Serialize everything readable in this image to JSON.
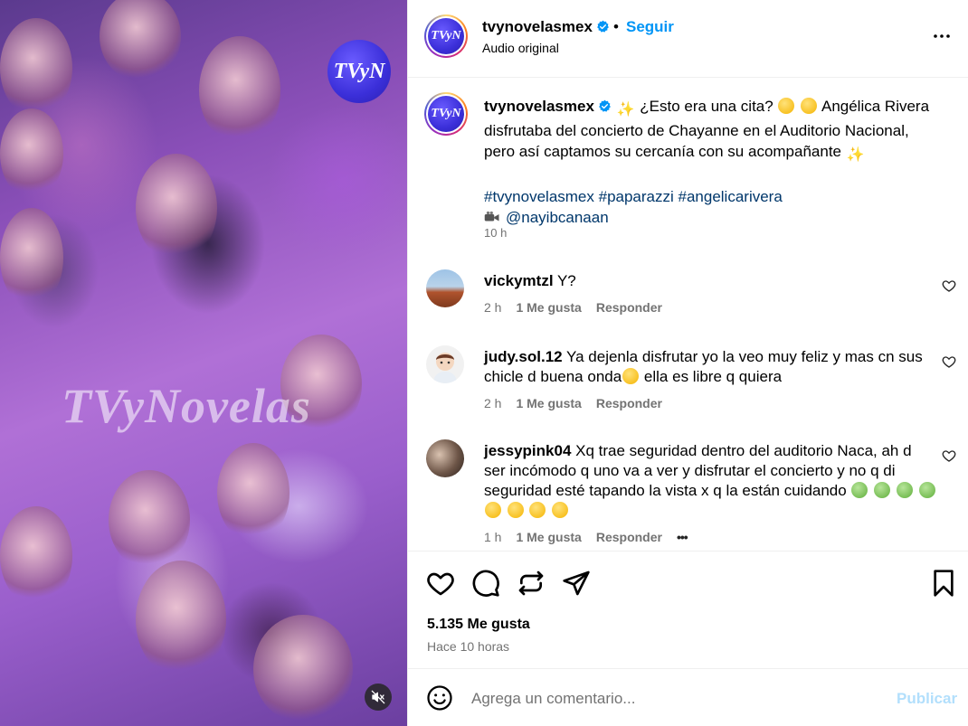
{
  "media": {
    "watermark": "TVyNovelas",
    "logo_text": "TVyN"
  },
  "header": {
    "username": "tvynovelasmex",
    "separator": "•",
    "follow_label": "Seguir",
    "audio": "Audio original",
    "avatar_text": "TVyN"
  },
  "caption": {
    "username": "tvynovelasmex",
    "text_1": "¿Esto era una cita?",
    "text_2": "Angélica Rivera disfrutaba del concierto de Chayanne en el Auditorio Nacional, pero así captamos su cercanía con su acompañante",
    "hashtags": "#tvynovelasmex #paparazzi #angelicarivera",
    "mention": "@nayibcanaan",
    "time": "10 h"
  },
  "comments": [
    {
      "username": "vickymtzl",
      "text": "Y?",
      "time": "2 h",
      "likes": "1 Me gusta",
      "reply": "Responder"
    },
    {
      "username": "judy.sol.12",
      "text_1": "Ya dejenla disfrutar yo la veo muy feliz y mas cn sus chicle d buena onda",
      "text_2": "ella es libre q quiera",
      "time": "2 h",
      "likes": "1 Me gusta",
      "reply": "Responder"
    },
    {
      "username": "jessypink04",
      "text": "Xq trae seguridad dentro del auditorio Naca, ah d ser incómodo q uno va a ver y disfrutar el concierto y no q di seguridad esté tapando la vista x q la están cuidando",
      "time": "1 h",
      "likes": "1 Me gusta",
      "reply": "Responder",
      "more": "•••"
    }
  ],
  "actions": {
    "likes_count": "5.135 Me gusta",
    "posted": "Hace 10 horas"
  },
  "compose": {
    "placeholder": "Agrega un comentario...",
    "post_label": "Publicar"
  },
  "colors": {
    "link": "#0095f6",
    "hashtag": "#00376b",
    "muted": "#737373",
    "post_disabled": "#b2dffc"
  }
}
